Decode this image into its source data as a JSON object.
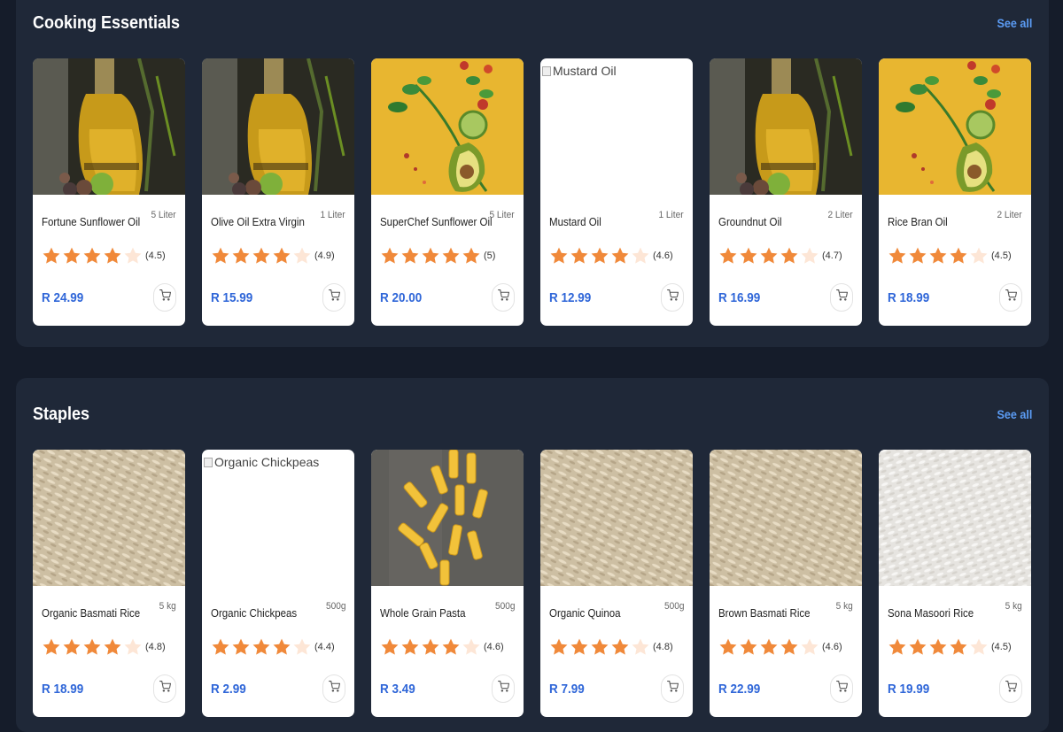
{
  "sections": [
    {
      "title": "Cooking Essentials",
      "see_all": "See all",
      "products": [
        {
          "name": "Fortune Sunflower Oil",
          "size": "5 Liter",
          "rating": 4.5,
          "rating_text": "(4.5)",
          "price": "R 24.99",
          "image": "oil-bottle",
          "alt": ""
        },
        {
          "name": "Olive Oil Extra Virgin",
          "size": "1 Liter",
          "rating": 4.9,
          "rating_text": "(4.9)",
          "price": "R 15.99",
          "image": "oil-bottle",
          "alt": ""
        },
        {
          "name": "SuperChef Sunflower Oil",
          "size": "5 Liter",
          "rating": 5,
          "rating_text": "(5)",
          "price": "R 20.00",
          "image": "vegetables-yellow",
          "alt": ""
        },
        {
          "name": "Mustard Oil",
          "size": "1 Liter",
          "rating": 4.6,
          "rating_text": "(4.6)",
          "price": "R 12.99",
          "image": "broken",
          "alt": "Mustard Oil"
        },
        {
          "name": "Groundnut Oil",
          "size": "2 Liter",
          "rating": 4.7,
          "rating_text": "(4.7)",
          "price": "R 16.99",
          "image": "oil-bottle",
          "alt": ""
        },
        {
          "name": "Rice Bran Oil",
          "size": "2 Liter",
          "rating": 4.5,
          "rating_text": "(4.5)",
          "price": "R 18.99",
          "image": "vegetables-yellow",
          "alt": ""
        }
      ]
    },
    {
      "title": "Staples",
      "see_all": "See all",
      "products": [
        {
          "name": "Organic Basmati Rice",
          "size": "5 kg",
          "rating": 4.8,
          "rating_text": "(4.8)",
          "price": "R 18.99",
          "image": "rice-brown",
          "alt": ""
        },
        {
          "name": "Organic Chickpeas",
          "size": "500g",
          "rating": 4.4,
          "rating_text": "(4.4)",
          "price": "R 2.99",
          "image": "broken",
          "alt": "Organic Chickpeas"
        },
        {
          "name": "Whole Grain Pasta",
          "size": "500g",
          "rating": 4.6,
          "rating_text": "(4.6)",
          "price": "R 3.49",
          "image": "pasta",
          "alt": ""
        },
        {
          "name": "Organic Quinoa",
          "size": "500g",
          "rating": 4.8,
          "rating_text": "(4.8)",
          "price": "R 7.99",
          "image": "rice-brown",
          "alt": ""
        },
        {
          "name": "Brown Basmati Rice",
          "size": "5 kg",
          "rating": 4.6,
          "rating_text": "(4.6)",
          "price": "R 22.99",
          "image": "rice-brown",
          "alt": ""
        },
        {
          "name": "Sona Masoori Rice",
          "size": "5 kg",
          "rating": 4.5,
          "rating_text": "(4.5)",
          "price": "R 19.99",
          "image": "rice-white",
          "alt": ""
        }
      ]
    }
  ],
  "colors": {
    "page_bg": "#151c2a",
    "section_bg": "#1f2838",
    "link": "#5b9cf5",
    "price": "#2f66d8",
    "star_filled": "#f0893a",
    "star_empty": "#fde6d6"
  },
  "icons": {
    "cart": "shopping-cart-icon",
    "star": "star-icon"
  }
}
